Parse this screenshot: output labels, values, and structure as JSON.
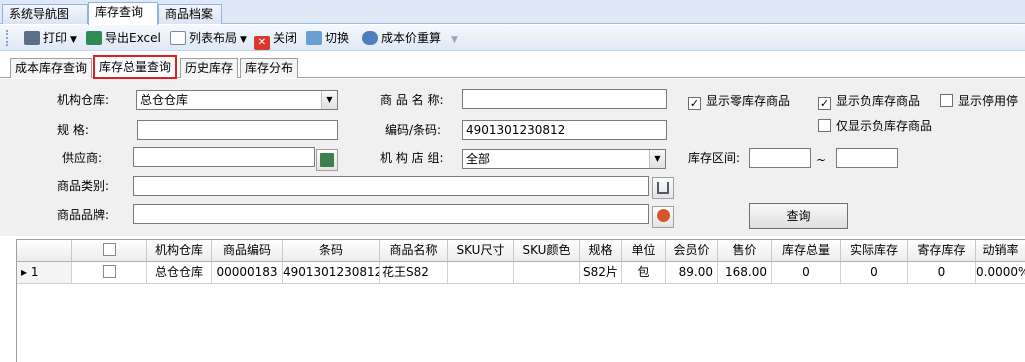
{
  "top_tabs": [
    "系统导航图",
    "库存查询",
    "商品档案"
  ],
  "toolbar": {
    "print": "打印",
    "export": "导出Excel",
    "layout": "列表布局",
    "close": "关闭",
    "switch": "切换",
    "recalc": "成本价重算",
    "icons": [
      "printer-icon",
      "excel-icon",
      "grid-layout-icon",
      "close-icon",
      "switch-icon",
      "recalculate-icon"
    ]
  },
  "sub_tabs": [
    "成本库存查询",
    "库存总量查询",
    "历史库存",
    "库存分布"
  ],
  "form": {
    "warehouse_label": "机构仓库:",
    "warehouse_value": "总仓仓库",
    "product_name_label": "商 品 名 称:",
    "product_name_value": "",
    "spec_label": "规      格:",
    "spec_value": "",
    "code_label": "编码/条码:",
    "code_value": "4901301230812",
    "supplier_label": "供应商:",
    "supplier_value": "",
    "store_group_label": "机 构 店 组:",
    "store_group_value": "全部",
    "stock_range_label": "库存区间:",
    "stock_range_sep": "~",
    "stock_min": "",
    "stock_max": "",
    "category_label": "商品类别:",
    "category_value": "",
    "brand_label": "商品品牌:",
    "brand_value": "",
    "show_zero_stock": "显示零库存商品",
    "show_negative_stock": "显示负库存商品",
    "show_disabled": "显示停用停",
    "only_negative_stock": "仅显示负库存商品",
    "query_button": "查询"
  },
  "checks": {
    "show_zero_stock": true,
    "show_negative_stock": true,
    "show_disabled": false,
    "only_negative_stock": false
  },
  "grid": {
    "columns": [
      "",
      "",
      "机构仓库",
      "商品编码",
      "条码",
      "商品名称",
      "SKU尺寸",
      "SKU颜色",
      "规格",
      "单位",
      "会员价",
      "售价",
      "库存总量",
      "实际库存",
      "寄存库存",
      "动销率"
    ],
    "rows": [
      [
        "▸ 1",
        "",
        "总仓仓库",
        "00000183",
        "4901301230812",
        "花王S82",
        "",
        "",
        "S82片",
        "包",
        "89.00",
        "168.00",
        "0",
        "0",
        "0",
        "0.0000%"
      ]
    ]
  },
  "colors": {
    "highlight_border": "#e02020",
    "tab_bg": "#dfe8f6"
  }
}
